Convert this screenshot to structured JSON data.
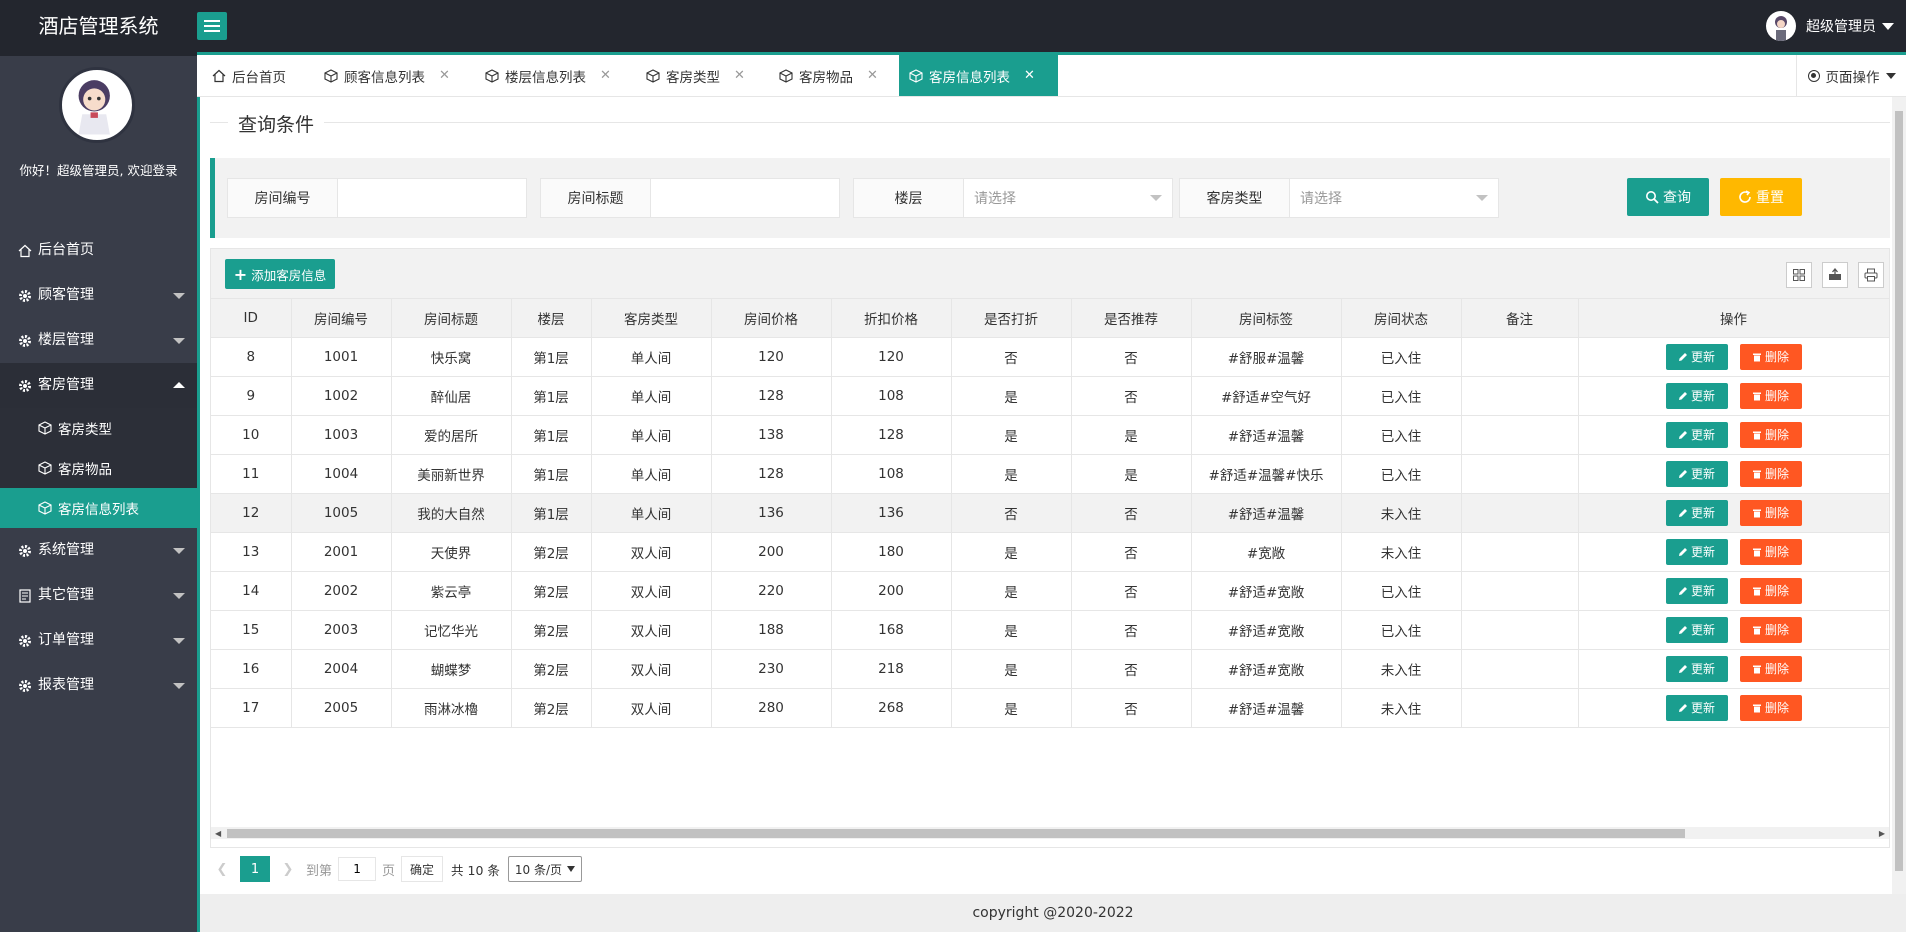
{
  "app": {
    "title": "酒店管理系统",
    "user_name": "超级管理员",
    "welcome": "你好！超级管理员, 欢迎登录",
    "footer": "copyright @2020-2022"
  },
  "colors": {
    "accent": "#1a9e8f",
    "header_bg": "#23262e",
    "sidebar_bg": "#393d49",
    "warning": "#ffb800",
    "danger": "#ff5722",
    "status_in": "#ff0000",
    "status_out": "#009900"
  },
  "sidebar": {
    "items": [
      {
        "label": "后台首页",
        "icon": "home-icon"
      },
      {
        "label": "顾客管理",
        "icon": "gear-icon"
      },
      {
        "label": "楼层管理",
        "icon": "gear-icon"
      },
      {
        "label": "客房管理",
        "icon": "gear-icon"
      },
      {
        "label": "系统管理",
        "icon": "gear-icon"
      },
      {
        "label": "其它管理",
        "icon": "document-icon"
      },
      {
        "label": "订单管理",
        "icon": "gear-icon"
      },
      {
        "label": "报表管理",
        "icon": "gear-icon"
      }
    ],
    "subitems": [
      {
        "label": "客房类型",
        "icon": "cube-icon"
      },
      {
        "label": "客房物品",
        "icon": "cube-icon"
      },
      {
        "label": "客房信息列表",
        "icon": "cube-icon"
      }
    ]
  },
  "tabs": [
    {
      "label": "后台首页"
    },
    {
      "label": "顾客信息列表"
    },
    {
      "label": "楼层信息列表"
    },
    {
      "label": "客房类型"
    },
    {
      "label": "客房物品"
    },
    {
      "label": "客房信息列表"
    }
  ],
  "page_ops": "页面操作",
  "query": {
    "legend": "查询条件",
    "room_no_label": "房间编号",
    "room_no_value": "",
    "room_title_label": "房间标题",
    "room_title_value": "",
    "floor_label": "楼层",
    "floor_placeholder": "请选择",
    "type_label": "客房类型",
    "type_placeholder": "请选择",
    "search_button": "查询",
    "reset_button": "重置"
  },
  "toolbar": {
    "add_button": "添加客房信息"
  },
  "table": {
    "columns": [
      "ID",
      "房间编号",
      "房间标题",
      "楼层",
      "客房类型",
      "房间价格",
      "折扣价格",
      "是否打折",
      "是否推荐",
      "房间标签",
      "房间状态",
      "备注",
      "操作"
    ],
    "update_label": "更新",
    "delete_label": "删除",
    "rows": [
      {
        "id": "8",
        "no": "1001",
        "title": "快乐窝",
        "floor": "第1层",
        "type": "单人间",
        "price": "120",
        "discount_price": "120",
        "is_discount": "否",
        "is_recommend": "否",
        "tags": "#舒服#温馨",
        "status": "已入住",
        "note": ""
      },
      {
        "id": "9",
        "no": "1002",
        "title": "醉仙居",
        "floor": "第1层",
        "type": "单人间",
        "price": "128",
        "discount_price": "108",
        "is_discount": "是",
        "is_recommend": "否",
        "tags": "#舒适#空气好",
        "status": "已入住",
        "note": ""
      },
      {
        "id": "10",
        "no": "1003",
        "title": "爱的居所",
        "floor": "第1层",
        "type": "单人间",
        "price": "138",
        "discount_price": "128",
        "is_discount": "是",
        "is_recommend": "是",
        "tags": "#舒适#温馨",
        "status": "已入住",
        "note": ""
      },
      {
        "id": "11",
        "no": "1004",
        "title": "美丽新世界",
        "floor": "第1层",
        "type": "单人间",
        "price": "128",
        "discount_price": "108",
        "is_discount": "是",
        "is_recommend": "是",
        "tags": "#舒适#温馨#快乐",
        "status": "已入住",
        "note": ""
      },
      {
        "id": "12",
        "no": "1005",
        "title": "我的大自然",
        "floor": "第1层",
        "type": "单人间",
        "price": "136",
        "discount_price": "136",
        "is_discount": "否",
        "is_recommend": "否",
        "tags": "#舒适#温馨",
        "status": "未入住",
        "note": ""
      },
      {
        "id": "13",
        "no": "2001",
        "title": "天使界",
        "floor": "第2层",
        "type": "双人间",
        "price": "200",
        "discount_price": "180",
        "is_discount": "是",
        "is_recommend": "否",
        "tags": "#宽敞",
        "status": "未入住",
        "note": ""
      },
      {
        "id": "14",
        "no": "2002",
        "title": "紫云亭",
        "floor": "第2层",
        "type": "双人间",
        "price": "220",
        "discount_price": "200",
        "is_discount": "是",
        "is_recommend": "否",
        "tags": "#舒适#宽敞",
        "status": "已入住",
        "note": ""
      },
      {
        "id": "15",
        "no": "2003",
        "title": "记忆华光",
        "floor": "第2层",
        "type": "双人间",
        "price": "188",
        "discount_price": "168",
        "is_discount": "是",
        "is_recommend": "否",
        "tags": "#舒适#宽敞",
        "status": "已入住",
        "note": ""
      },
      {
        "id": "16",
        "no": "2004",
        "title": "蝴蝶梦",
        "floor": "第2层",
        "type": "双人间",
        "price": "230",
        "discount_price": "218",
        "is_discount": "是",
        "is_recommend": "否",
        "tags": "#舒适#宽敞",
        "status": "未入住",
        "note": ""
      },
      {
        "id": "17",
        "no": "2005",
        "title": "雨淋冰櫓",
        "floor": "第2层",
        "type": "双人间",
        "price": "280",
        "discount_price": "268",
        "is_discount": "是",
        "is_recommend": "否",
        "tags": "#舒适#温馨",
        "status": "未入住",
        "note": ""
      }
    ]
  },
  "pager": {
    "current": "1",
    "goto_label": "到第",
    "page_input": "1",
    "page_unit": "页",
    "confirm": "确定",
    "total": "共 10 条",
    "page_size": "10 条/页"
  }
}
